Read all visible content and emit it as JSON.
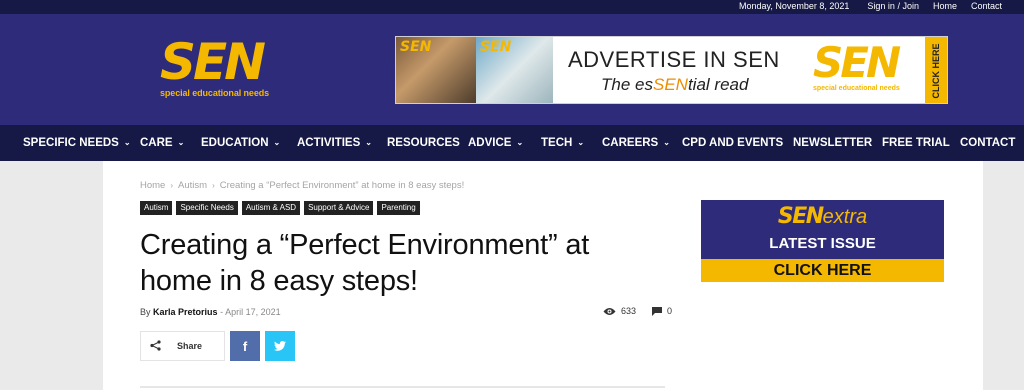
{
  "topbar": {
    "date": "Monday, November 8, 2021",
    "links": [
      "Sign in / Join",
      "Home",
      "Contact"
    ]
  },
  "logo": {
    "text": "SEN",
    "subtitle": "special educational needs"
  },
  "ad": {
    "mag_logo": "SEN",
    "headline": "ADVERTISE IN SEN",
    "tagline_pre": "The es",
    "tagline_hl": "SEN",
    "tagline_post": "tial read",
    "logo_text": "SEN",
    "logo_subtitle": "special educational needs",
    "cta": "CLICK HERE"
  },
  "nav": {
    "items": [
      {
        "label": "SPECIFIC NEEDS",
        "chevron": true
      },
      {
        "label": "CARE",
        "chevron": true
      },
      {
        "label": "EDUCATION",
        "chevron": true
      },
      {
        "label": "ACTIVITIES",
        "chevron": true
      },
      {
        "label": "RESOURCES",
        "chevron": false
      },
      {
        "label": "ADVICE",
        "chevron": true
      },
      {
        "label": "TECH",
        "chevron": true
      },
      {
        "label": "CAREERS",
        "chevron": true
      },
      {
        "label": "CPD AND EVENTS",
        "chevron": false
      },
      {
        "label": "NEWSLETTER",
        "chevron": false
      },
      {
        "label": "FREE TRIAL",
        "chevron": false
      },
      {
        "label": "CONTACT",
        "chevron": false
      }
    ]
  },
  "breadcrumb": [
    "Home",
    "Autism",
    "Creating a “Perfect Environment” at home in 8 easy steps!"
  ],
  "tags": [
    "Autism",
    "Specific Needs",
    "Autism & ASD",
    "Support & Advice",
    "Parenting"
  ],
  "article": {
    "title": "Creating a “Perfect Environment” at home in 8 easy steps!",
    "by": "By",
    "author": "Karla Pretorius",
    "date": "April 17, 2021",
    "views": "633",
    "comments": "0"
  },
  "share": {
    "label": "Share"
  },
  "sidebar_promo": {
    "logo": "SEN",
    "logo_suffix": "extra",
    "line": "LATEST ISSUE",
    "cta": "CLICK HERE"
  },
  "colors": {
    "header_bg": "#2d2b7a",
    "nav_bg": "#161845",
    "brand_yellow": "#f5b800",
    "facebook": "#516eab",
    "twitter": "#29c5f6"
  }
}
